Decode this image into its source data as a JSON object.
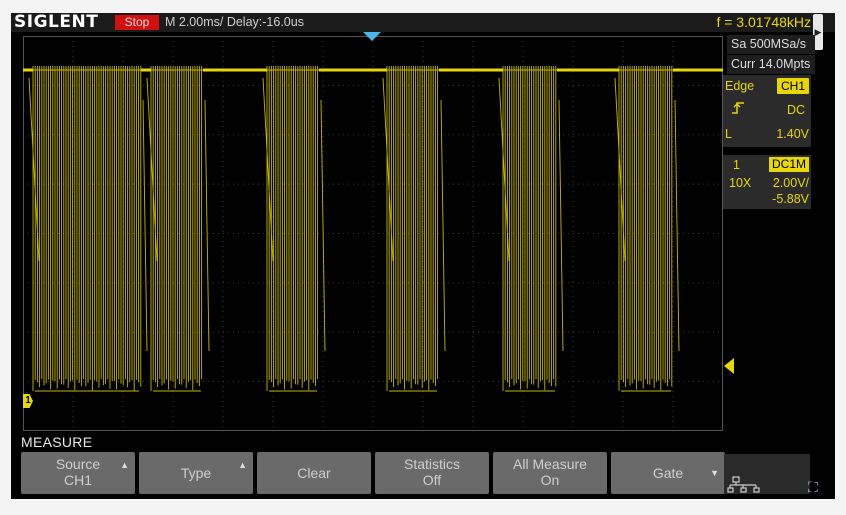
{
  "topbar": {
    "logo": "SIGLENT",
    "status": "Stop",
    "timebase": "M 2.00ms/ Delay:-16.0us",
    "frequency": "f = 3.01748kHz"
  },
  "acquisition": {
    "sample_rate": "Sa 500MSa/s",
    "memory_depth": "Curr 14.0Mpts"
  },
  "trigger": {
    "type": "Edge",
    "source": "CH1",
    "slope_icon": "rising-edge-icon",
    "coupling": "DC",
    "level_label": "L",
    "level_value": "1.40V"
  },
  "channel": {
    "number": "1",
    "coupling": "DC1M",
    "probe": "10X",
    "scale": "2.00V/",
    "offset": "-5.88V",
    "color": "#e7d60a"
  },
  "menu": {
    "title": "MEASURE",
    "softkeys": [
      {
        "line1": "Source",
        "line2": "CH1",
        "arrow": "up"
      },
      {
        "line1": "Type",
        "line2": "",
        "arrow": "up"
      },
      {
        "line1": "Clear",
        "line2": "",
        "arrow": ""
      },
      {
        "line1": "Statistics",
        "line2": "Off",
        "arrow": ""
      },
      {
        "line1": "All Measure",
        "line2": "On",
        "arrow": ""
      },
      {
        "line1": "Gate",
        "line2": "",
        "arrow": "down"
      }
    ],
    "network_icon": "network-icon",
    "expand_icon": "expand-icon"
  },
  "colors": {
    "trace": "#e7d60a",
    "trigger_marker": "#4fb3e8",
    "status_stop": "#d01010"
  }
}
